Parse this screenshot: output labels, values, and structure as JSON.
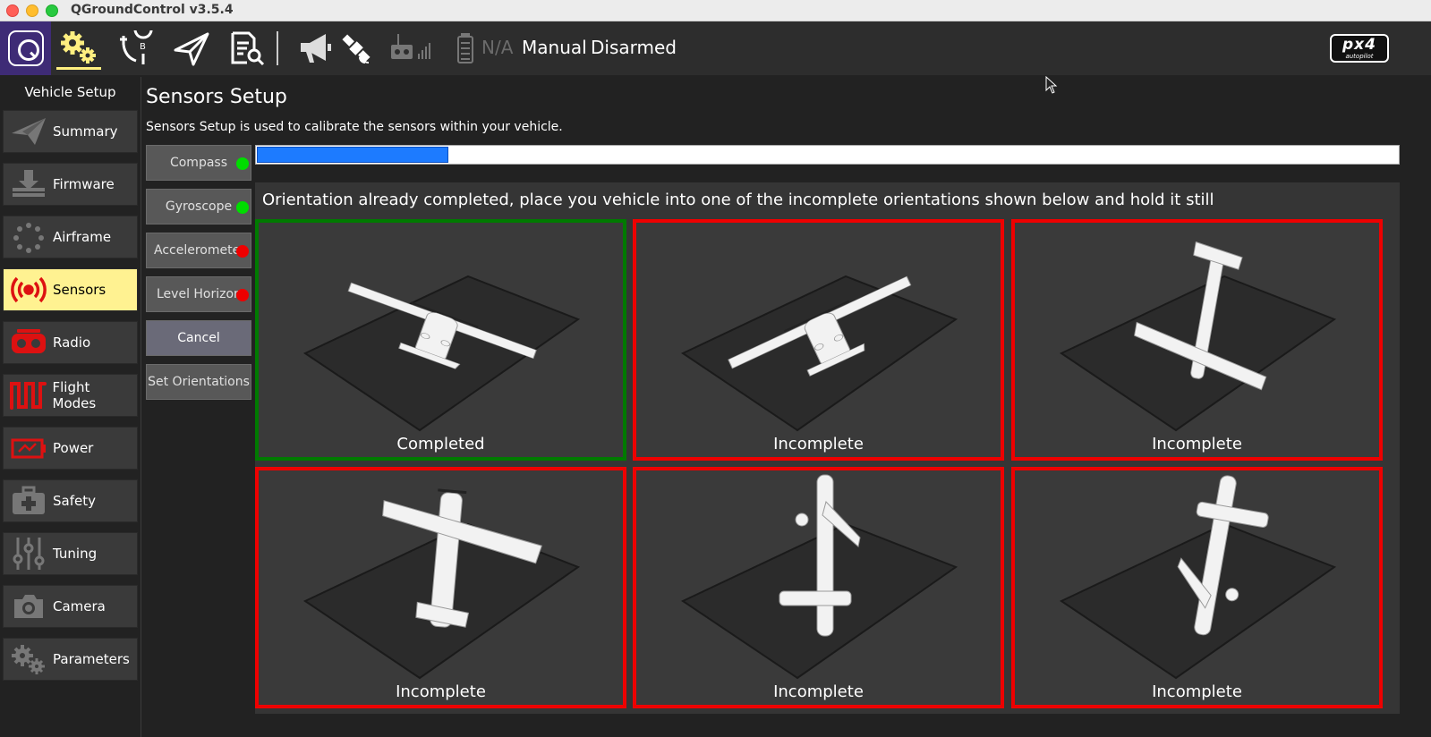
{
  "window": {
    "title": "QGroundControl v3.5.4"
  },
  "toolbar": {
    "icons": [
      "qgc-logo-icon",
      "vehicle-setup-gear-icon",
      "plan-route-icon",
      "fly-paper-plane-icon",
      "analyze-document-icon",
      "megaphone-icon",
      "satellite-icon",
      "rc-transmitter-icon",
      "signal-bars-icon",
      "battery-icon"
    ],
    "battery_text": "N/A",
    "flight_mode": "Manual",
    "arm_state": "Disarmed",
    "brand_logo": {
      "big": "px4",
      "small": "autopilot"
    }
  },
  "nav": {
    "title": "Vehicle Setup",
    "selected": "Sensors",
    "items": [
      {
        "label": "Summary",
        "icon": "paper-plane-icon"
      },
      {
        "label": "Firmware",
        "icon": "download-icon"
      },
      {
        "label": "Airframe",
        "icon": "airframe-dots-icon"
      },
      {
        "label": "Sensors",
        "icon": "sensors-broadcast-icon"
      },
      {
        "label": "Radio",
        "icon": "radio-icon"
      },
      {
        "label": "Flight Modes",
        "icon": "flight-modes-wave-icon"
      },
      {
        "label": "Power",
        "icon": "power-battery-icon"
      },
      {
        "label": "Safety",
        "icon": "safety-medkit-icon"
      },
      {
        "label": "Tuning",
        "icon": "tuning-sliders-icon"
      },
      {
        "label": "Camera",
        "icon": "camera-icon"
      },
      {
        "label": "Parameters",
        "icon": "parameters-gears-icon"
      }
    ]
  },
  "page": {
    "title": "Sensors Setup",
    "description": "Sensors Setup is used to calibrate the sensors within your vehicle."
  },
  "sensor_buttons": [
    {
      "label": "Compass",
      "status": "green"
    },
    {
      "label": "Gyroscope",
      "status": "green"
    },
    {
      "label": "Accelerometer",
      "status": "red"
    },
    {
      "label": "Level Horizon",
      "status": "red"
    }
  ],
  "actions": {
    "cancel": "Cancel",
    "set_orientations": "Set Orientations"
  },
  "progress": {
    "fraction": 0.168
  },
  "calibration": {
    "message": "Orientation already completed, place you vehicle into one of the incomplete orientations shown below and hold it still",
    "orientations": [
      {
        "status": "Completed",
        "done": true
      },
      {
        "status": "Incomplete",
        "done": false
      },
      {
        "status": "Incomplete",
        "done": false
      },
      {
        "status": "Incomplete",
        "done": false
      },
      {
        "status": "Incomplete",
        "done": false
      },
      {
        "status": "Incomplete",
        "done": false
      }
    ]
  },
  "colors": {
    "accent_purple": "#3e2b76",
    "selected_yellow": "#fff291",
    "progress_blue": "#1d7bff",
    "done_green": "#007a00",
    "incomplete_red": "#ee0000"
  }
}
